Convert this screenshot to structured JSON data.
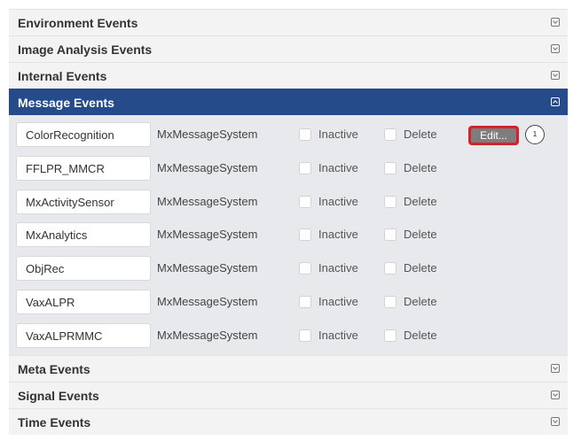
{
  "sections_top": [
    {
      "label": "Environment Events"
    },
    {
      "label": "Image Analysis Events"
    },
    {
      "label": "Internal Events"
    }
  ],
  "active_section": {
    "label": "Message Events"
  },
  "rows": [
    {
      "name": "ColorRecognition",
      "system": "MxMessageSystem",
      "inactive_label": "Inactive",
      "delete_label": "Delete",
      "inactive_checked": false,
      "delete_checked": false
    },
    {
      "name": "FFLPR_MMCR",
      "system": "MxMessageSystem",
      "inactive_label": "Inactive",
      "delete_label": "Delete",
      "inactive_checked": false,
      "delete_checked": false
    },
    {
      "name": "MxActivitySensor",
      "system": "MxMessageSystem",
      "inactive_label": "Inactive",
      "delete_label": "Delete",
      "inactive_checked": false,
      "delete_checked": false
    },
    {
      "name": "MxAnalytics",
      "system": "MxMessageSystem",
      "inactive_label": "Inactive",
      "delete_label": "Delete",
      "inactive_checked": false,
      "delete_checked": false
    },
    {
      "name": "ObjRec",
      "system": "MxMessageSystem",
      "inactive_label": "Inactive",
      "delete_label": "Delete",
      "inactive_checked": false,
      "delete_checked": false
    },
    {
      "name": "VaxALPR",
      "system": "MxMessageSystem",
      "inactive_label": "Inactive",
      "delete_label": "Delete",
      "inactive_checked": false,
      "delete_checked": false
    },
    {
      "name": "VaxALPRMMC",
      "system": "MxMessageSystem",
      "inactive_label": "Inactive",
      "delete_label": "Delete",
      "inactive_checked": false,
      "delete_checked": false
    }
  ],
  "edit_button": {
    "label": "Edit..."
  },
  "callout": {
    "label": "1"
  },
  "sections_bottom": [
    {
      "label": "Meta Events"
    },
    {
      "label": "Signal Events"
    },
    {
      "label": "Time Events"
    }
  ],
  "colors": {
    "header_active": "#254b8a",
    "highlight": "#d81f2a",
    "edit_button": "#7d7d7d",
    "body_bg": "#e8e9ec"
  },
  "icons": {
    "expand": "expand-icon",
    "collapse": "collapse-icon"
  }
}
